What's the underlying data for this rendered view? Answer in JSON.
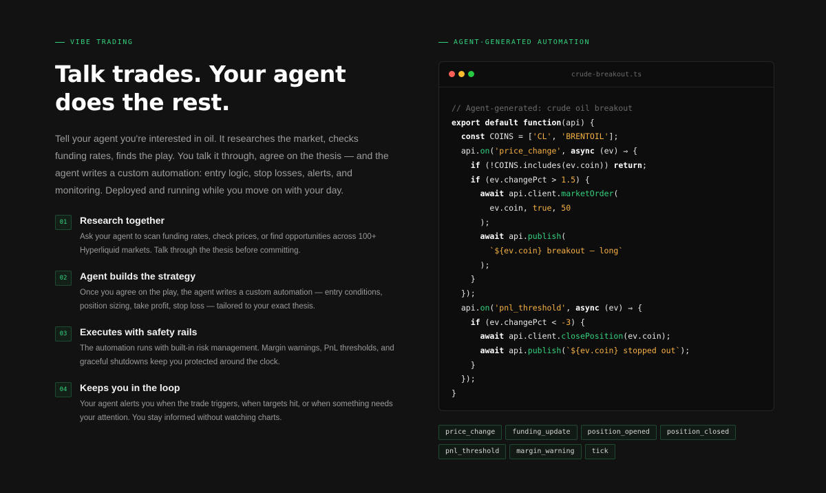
{
  "left": {
    "eyebrow": "VIBE TRADING",
    "headline_line1": "Talk trades. Your agent",
    "headline_line2": "does the rest.",
    "intro": "Tell your agent you're interested in oil. It researches the market, checks funding rates, finds the play. You talk it through, agree on the thesis — and the agent writes a custom automation: entry logic, stop losses, alerts, and monitoring. Deployed and running while you move on with your day.",
    "steps": [
      {
        "num": "01",
        "title": "Research together",
        "desc": "Ask your agent to scan funding rates, check prices, or find opportunities across 100+ Hyperliquid markets. Talk through the thesis before committing."
      },
      {
        "num": "02",
        "title": "Agent builds the strategy",
        "desc": "Once you agree on the play, the agent writes a custom automation — entry conditions, position sizing, take profit, stop loss — tailored to your exact thesis."
      },
      {
        "num": "03",
        "title": "Executes with safety rails",
        "desc": "The automation runs with built-in risk management. Margin warnings, PnL thresholds, and graceful shutdowns keep you protected around the clock."
      },
      {
        "num": "04",
        "title": "Keeps you in the loop",
        "desc": "Your agent alerts you when the trade triggers, when targets hit, or when something needs your attention. You stay informed without watching charts."
      }
    ]
  },
  "right": {
    "eyebrow": "AGENT-GENERATED AUTOMATION",
    "filename": "crude-breakout.ts",
    "window_dot_colors": [
      "#ff5f57",
      "#febc2e",
      "#28c840"
    ],
    "accent_color": "#34d27e",
    "string_color": "#f5b043",
    "code": {
      "comment": "// Agent-generated: crude oil breakout",
      "kw_export": "export default function",
      "fn_sig": "(api) {",
      "kw_const": "const",
      "coins_lhs": " COINS = [",
      "coin_cl": "'CL'",
      "comma": ", ",
      "coin_brent": "'BRENTOIL'",
      "coins_end": "];",
      "api": "api.",
      "on": "on",
      "evt_price": "'price_change'",
      "kw_async": "async",
      "arrow_tail": " (ev) ⇒ {",
      "kw_if": "if",
      "cond1": " (!COINS.includes(ev.coin)) ",
      "kw_return": "return",
      "semi": ";",
      "cond2": " (ev.changePct > ",
      "num_15": "1.5",
      "brace_open": ") {",
      "kw_await": "await",
      "client": " api.client.",
      "market_order": "marketOrder",
      "paren_open": "(",
      "args_coin": "ev.coin, ",
      "kw_true": "true",
      "num_50": "50",
      "paren_close": ");",
      "api_dot": " api.",
      "publish": "publish",
      "breakout_str": "`${ev.coin} breakout — long`",
      "close_brace": "}",
      "close_on": "});",
      "evt_pnl": "'pnl_threshold'",
      "cond3": " (ev.changePct < ",
      "num_neg3": "-3",
      "close_position": "closePosition",
      "close_args": "(ev.coin);",
      "stopped_str": "`${ev.coin} stopped out`",
      "paren_semi": ");"
    },
    "tags": [
      "price_change",
      "funding_update",
      "position_opened",
      "position_closed",
      "pnl_threshold",
      "margin_warning",
      "tick"
    ]
  }
}
